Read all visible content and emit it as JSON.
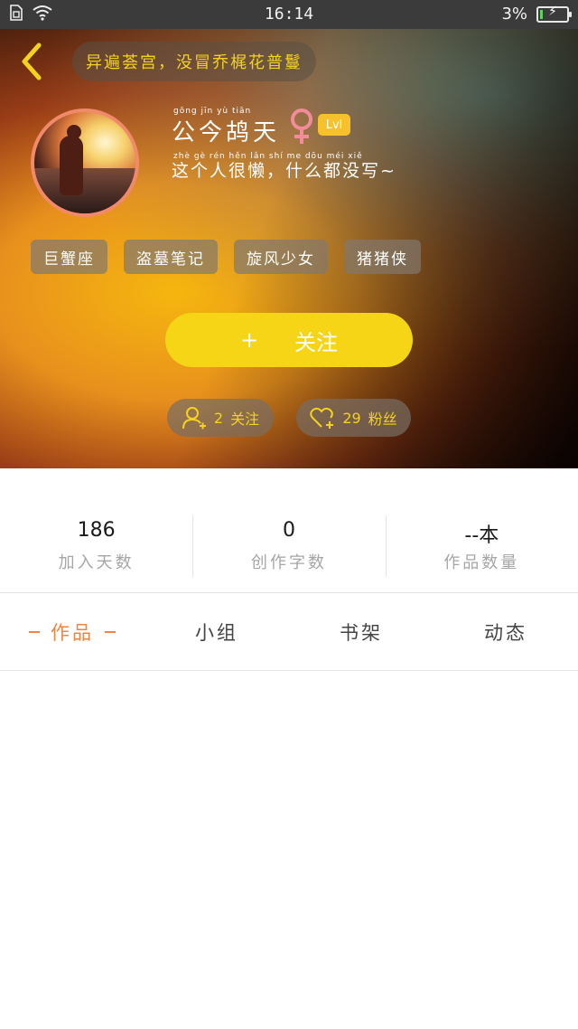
{
  "status_bar": {
    "time": "16:14",
    "battery": "3%",
    "battery_level": 0.03
  },
  "header": {
    "motto": "异遍荟宫，没冒乔梶花普鬘",
    "username": "公今鸪天",
    "username_pinyin": "gōng  jīn  yù  tiān",
    "level": "Lvl",
    "bio": "这个人很懒，什么都没写~",
    "bio_pinyin": "zhè gè rén hěn lǎn    shí me dōu méi xiě",
    "tags": [
      {
        "label": "巨蟹座"
      },
      {
        "label": "盗墓笔记"
      },
      {
        "label": "旋风少女"
      },
      {
        "label": "猪猪侠"
      }
    ],
    "follow_button": {
      "plus": "+",
      "label": "关注"
    },
    "following": {
      "count": "2",
      "label": "关注"
    },
    "fans": {
      "count": "29",
      "label": "粉丝"
    }
  },
  "stats": [
    {
      "value": "186",
      "label": "加入天数"
    },
    {
      "value": "0",
      "label": "创作字数"
    },
    {
      "value": "--本",
      "label": "作品数量"
    }
  ],
  "tabs": [
    {
      "label": "作品",
      "active": true
    },
    {
      "label": "小组",
      "active": false
    },
    {
      "label": "书架",
      "active": false
    },
    {
      "label": "动态",
      "active": false
    }
  ],
  "colors": {
    "accent_yellow": "#f6d517",
    "accent_orange": "#f08440",
    "female_pink": "#f28b9a"
  }
}
